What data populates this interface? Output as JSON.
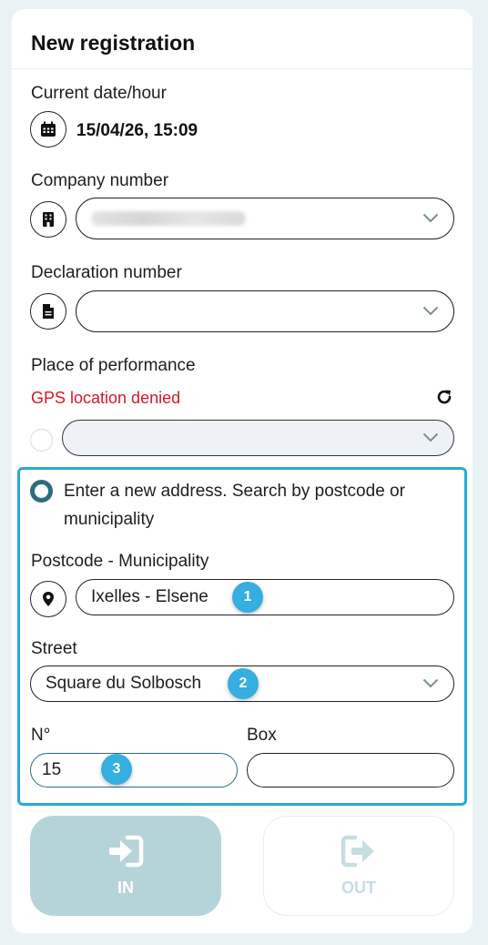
{
  "form": {
    "title": "New registration",
    "date": {
      "label": "Current date/hour",
      "value": "15/04/26, 15:09",
      "icon": "calendar-icon"
    },
    "company": {
      "label": "Company number",
      "icon": "building-icon"
    },
    "declaration": {
      "label": "Declaration number",
      "value": "",
      "icon": "document-icon"
    },
    "place": {
      "label": "Place of performance",
      "error": "GPS location denied",
      "icon": "refresh-icon"
    },
    "new_address": {
      "option_label": "Enter a new address. Search by postcode or municipality",
      "postcode": {
        "label": "Postcode - Municipality",
        "value": "Ixelles - Elsene",
        "icon": "location-pin-icon"
      },
      "street": {
        "label": "Street",
        "value": "Square du Solbosch"
      },
      "number": {
        "label": "N°",
        "value": "15"
      },
      "box": {
        "label": "Box",
        "value": ""
      }
    }
  },
  "badges": [
    "1",
    "2",
    "3"
  ],
  "actions": {
    "in_label": "IN",
    "out_label": "OUT"
  },
  "colors": {
    "accent": "#27a9d8",
    "badge": "#35aee0",
    "error": "#d3182a",
    "in_button": "#b5d4da",
    "radio": "#2c6c80"
  }
}
